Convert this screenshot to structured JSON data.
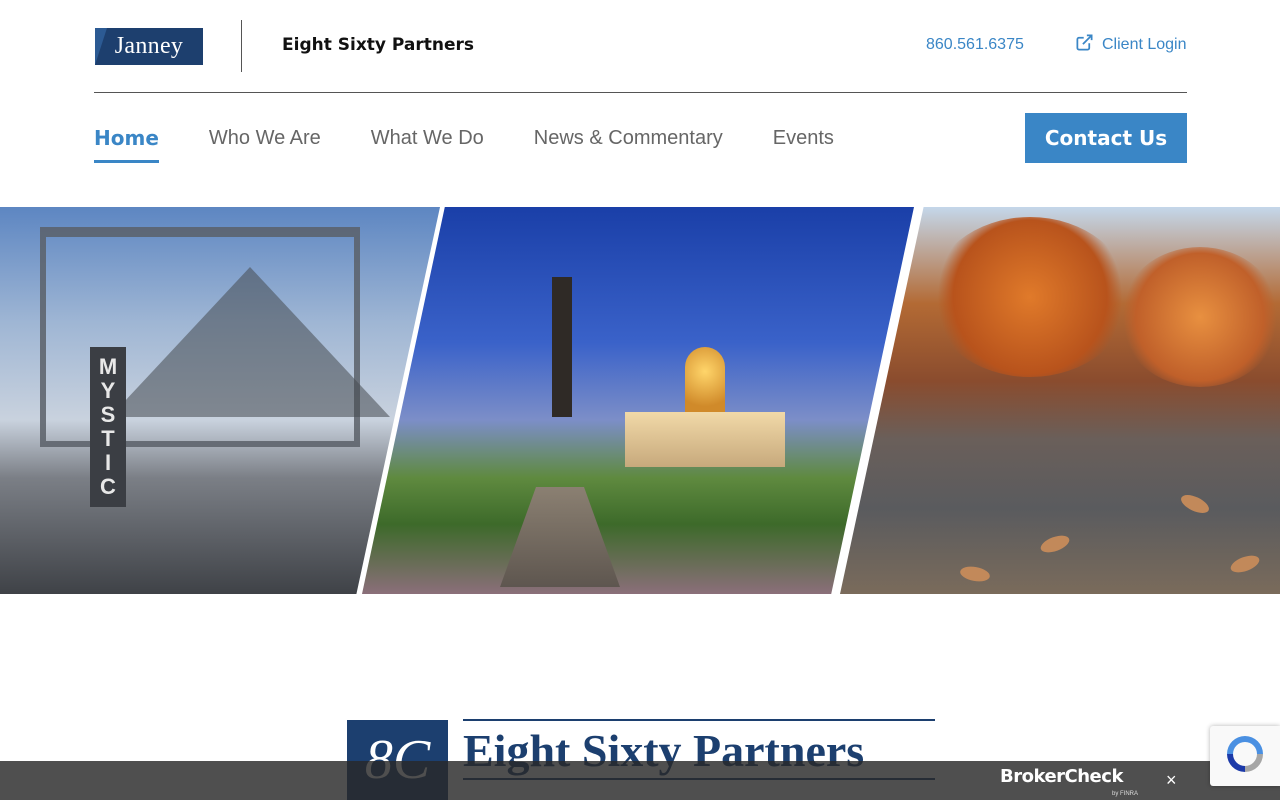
{
  "header": {
    "janney_logo_text": "Janney",
    "firm_name": "Eight Sixty Partners",
    "phone": "860.561.6375",
    "client_login": "Client Login"
  },
  "nav": {
    "items": [
      {
        "label": "Home",
        "active": true
      },
      {
        "label": "Who We Are",
        "active": false
      },
      {
        "label": "What We Do",
        "active": false
      },
      {
        "label": "News & Commentary",
        "active": false
      },
      {
        "label": "Events",
        "active": false
      }
    ],
    "contact_label": "Contact Us"
  },
  "hero": {
    "panel1_sign": [
      "M",
      "Y",
      "S",
      "T",
      "I",
      "C"
    ]
  },
  "lower_logo": {
    "monogram": "8C",
    "name": "Eight Sixty Partners"
  },
  "brokercheck": {
    "logo_text": "BrokerCheck",
    "by_text": "by FINRA",
    "close": "×"
  },
  "colors": {
    "accent": "#3a86c6",
    "navy": "#1c3f6f",
    "nav_text": "#666666"
  },
  "icons": {
    "client_login": "external-link-icon",
    "recaptcha": "recaptcha-icon"
  }
}
